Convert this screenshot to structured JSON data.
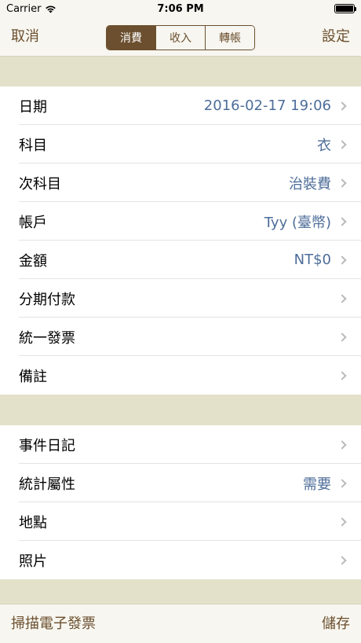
{
  "status": {
    "carrier": "Carrier",
    "time": "7:06 PM"
  },
  "nav": {
    "cancel": "取消",
    "settings": "設定",
    "segments": [
      {
        "label": "消費",
        "active": true
      },
      {
        "label": "收入",
        "active": false
      },
      {
        "label": "轉帳",
        "active": false
      }
    ]
  },
  "group1": [
    {
      "label": "日期",
      "value": "2016-02-17 19:06"
    },
    {
      "label": "科目",
      "value": "衣"
    },
    {
      "label": "次科目",
      "value": "治裝費"
    },
    {
      "label": "帳戶",
      "value": "Tyy (臺幣)"
    },
    {
      "label": "金額",
      "value": "NT$0"
    },
    {
      "label": "分期付款",
      "value": ""
    },
    {
      "label": "統一發票",
      "value": ""
    },
    {
      "label": "備註",
      "value": ""
    }
  ],
  "group2": [
    {
      "label": "事件日記",
      "value": ""
    },
    {
      "label": "統計屬性",
      "value": "需要"
    },
    {
      "label": "地點",
      "value": ""
    },
    {
      "label": "照片",
      "value": ""
    }
  ],
  "bottom": {
    "scan": "掃描電子發票",
    "save": "儲存"
  },
  "colors": {
    "accent": "#6b4f2e",
    "value_text": "#4d6d99",
    "section_bg": "#e3e1c9"
  }
}
